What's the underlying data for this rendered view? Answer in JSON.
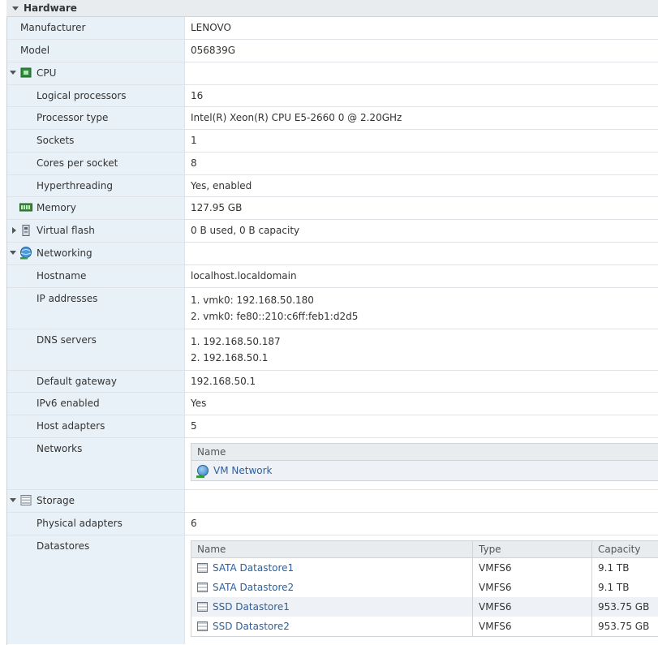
{
  "header": {
    "title": "Hardware"
  },
  "rows": {
    "manufacturer": {
      "label": "Manufacturer",
      "value": "LENOVO"
    },
    "model": {
      "label": "Model",
      "value": "056839G"
    },
    "cpu": {
      "label": "CPU"
    },
    "logical": {
      "label": "Logical processors",
      "value": "16"
    },
    "ptype": {
      "label": "Processor type",
      "value": "Intel(R) Xeon(R) CPU E5-2660 0 @ 2.20GHz"
    },
    "sockets": {
      "label": "Sockets",
      "value": "1"
    },
    "cores": {
      "label": "Cores per socket",
      "value": "8"
    },
    "ht": {
      "label": "Hyperthreading",
      "value": "Yes, enabled"
    },
    "memory": {
      "label": "Memory",
      "value": "127.95 GB"
    },
    "vflash": {
      "label": "Virtual flash",
      "value": "0 B used, 0 B capacity"
    },
    "networking": {
      "label": "Networking"
    },
    "hostname": {
      "label": "Hostname",
      "value": "localhost.localdomain"
    },
    "ip": {
      "label": "IP addresses",
      "values": [
        "1. vmk0: 192.168.50.180",
        "2. vmk0: fe80::210:c6ff:feb1:d2d5"
      ]
    },
    "dns": {
      "label": "DNS servers",
      "values": [
        "1. 192.168.50.187",
        "2. 192.168.50.1"
      ]
    },
    "gateway": {
      "label": "Default gateway",
      "value": "192.168.50.1"
    },
    "ipv6": {
      "label": "IPv6 enabled",
      "value": "Yes"
    },
    "hostadapters": {
      "label": "Host adapters",
      "value": "5"
    },
    "networks": {
      "label": "Networks",
      "col_name": "Name",
      "items": [
        "VM Network"
      ]
    },
    "storage": {
      "label": "Storage"
    },
    "physadapters": {
      "label": "Physical adapters",
      "value": "6"
    },
    "datastores": {
      "label": "Datastores",
      "columns": [
        "Name",
        "Type",
        "Capacity"
      ],
      "rows": [
        {
          "name": "SATA Datastore1",
          "type": "VMFS6",
          "capacity": "9.1 TB"
        },
        {
          "name": "SATA Datastore2",
          "type": "VMFS6",
          "capacity": "9.1 TB"
        },
        {
          "name": "SSD Datastore1",
          "type": "VMFS6",
          "capacity": "953.75 GB"
        },
        {
          "name": "SSD Datastore2",
          "type": "VMFS6",
          "capacity": "953.75 GB"
        }
      ]
    }
  }
}
